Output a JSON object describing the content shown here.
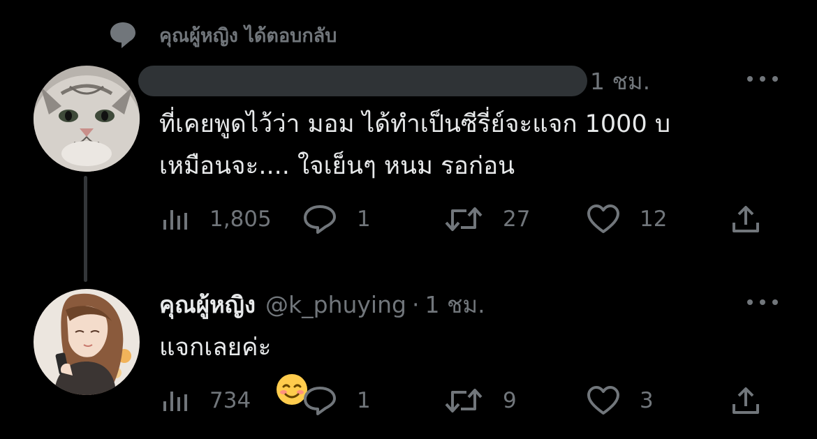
{
  "context": {
    "label": "คุณผู้หญิง ได้ตอบกลับ",
    "icon": "speech-bubble-icon"
  },
  "tweets": [
    {
      "author": {
        "display_name": "",
        "handle": "",
        "avatar": "cat-avatar"
      },
      "time": "1 ชม.",
      "text": "ที่เคยพูดไว้ว่า มอม ได้ทำเป็นซีรี่ย์จะแจก 1000 บ\nเหมือนจะ.... ใจเย็นๆ หนม รอก่อน",
      "stats": {
        "views": "1,805",
        "replies": "1",
        "retweets": "27",
        "likes": "12"
      }
    },
    {
      "author": {
        "display_name": "คุณผู้หญิง",
        "handle": "@k_phuying",
        "avatar": "anime-girl-avatar"
      },
      "time": "1 ชม.",
      "text": "แจกเลยค่ะ",
      "emoji": "smiling-face-emoji",
      "stats": {
        "views": "734",
        "replies": "1",
        "retweets": "9",
        "likes": "3"
      }
    }
  ],
  "colors": {
    "background": "#000000",
    "text_primary": "#e7e9ea",
    "text_secondary": "#71767b",
    "thread_line": "#333639",
    "redaction": "#2f3336"
  }
}
